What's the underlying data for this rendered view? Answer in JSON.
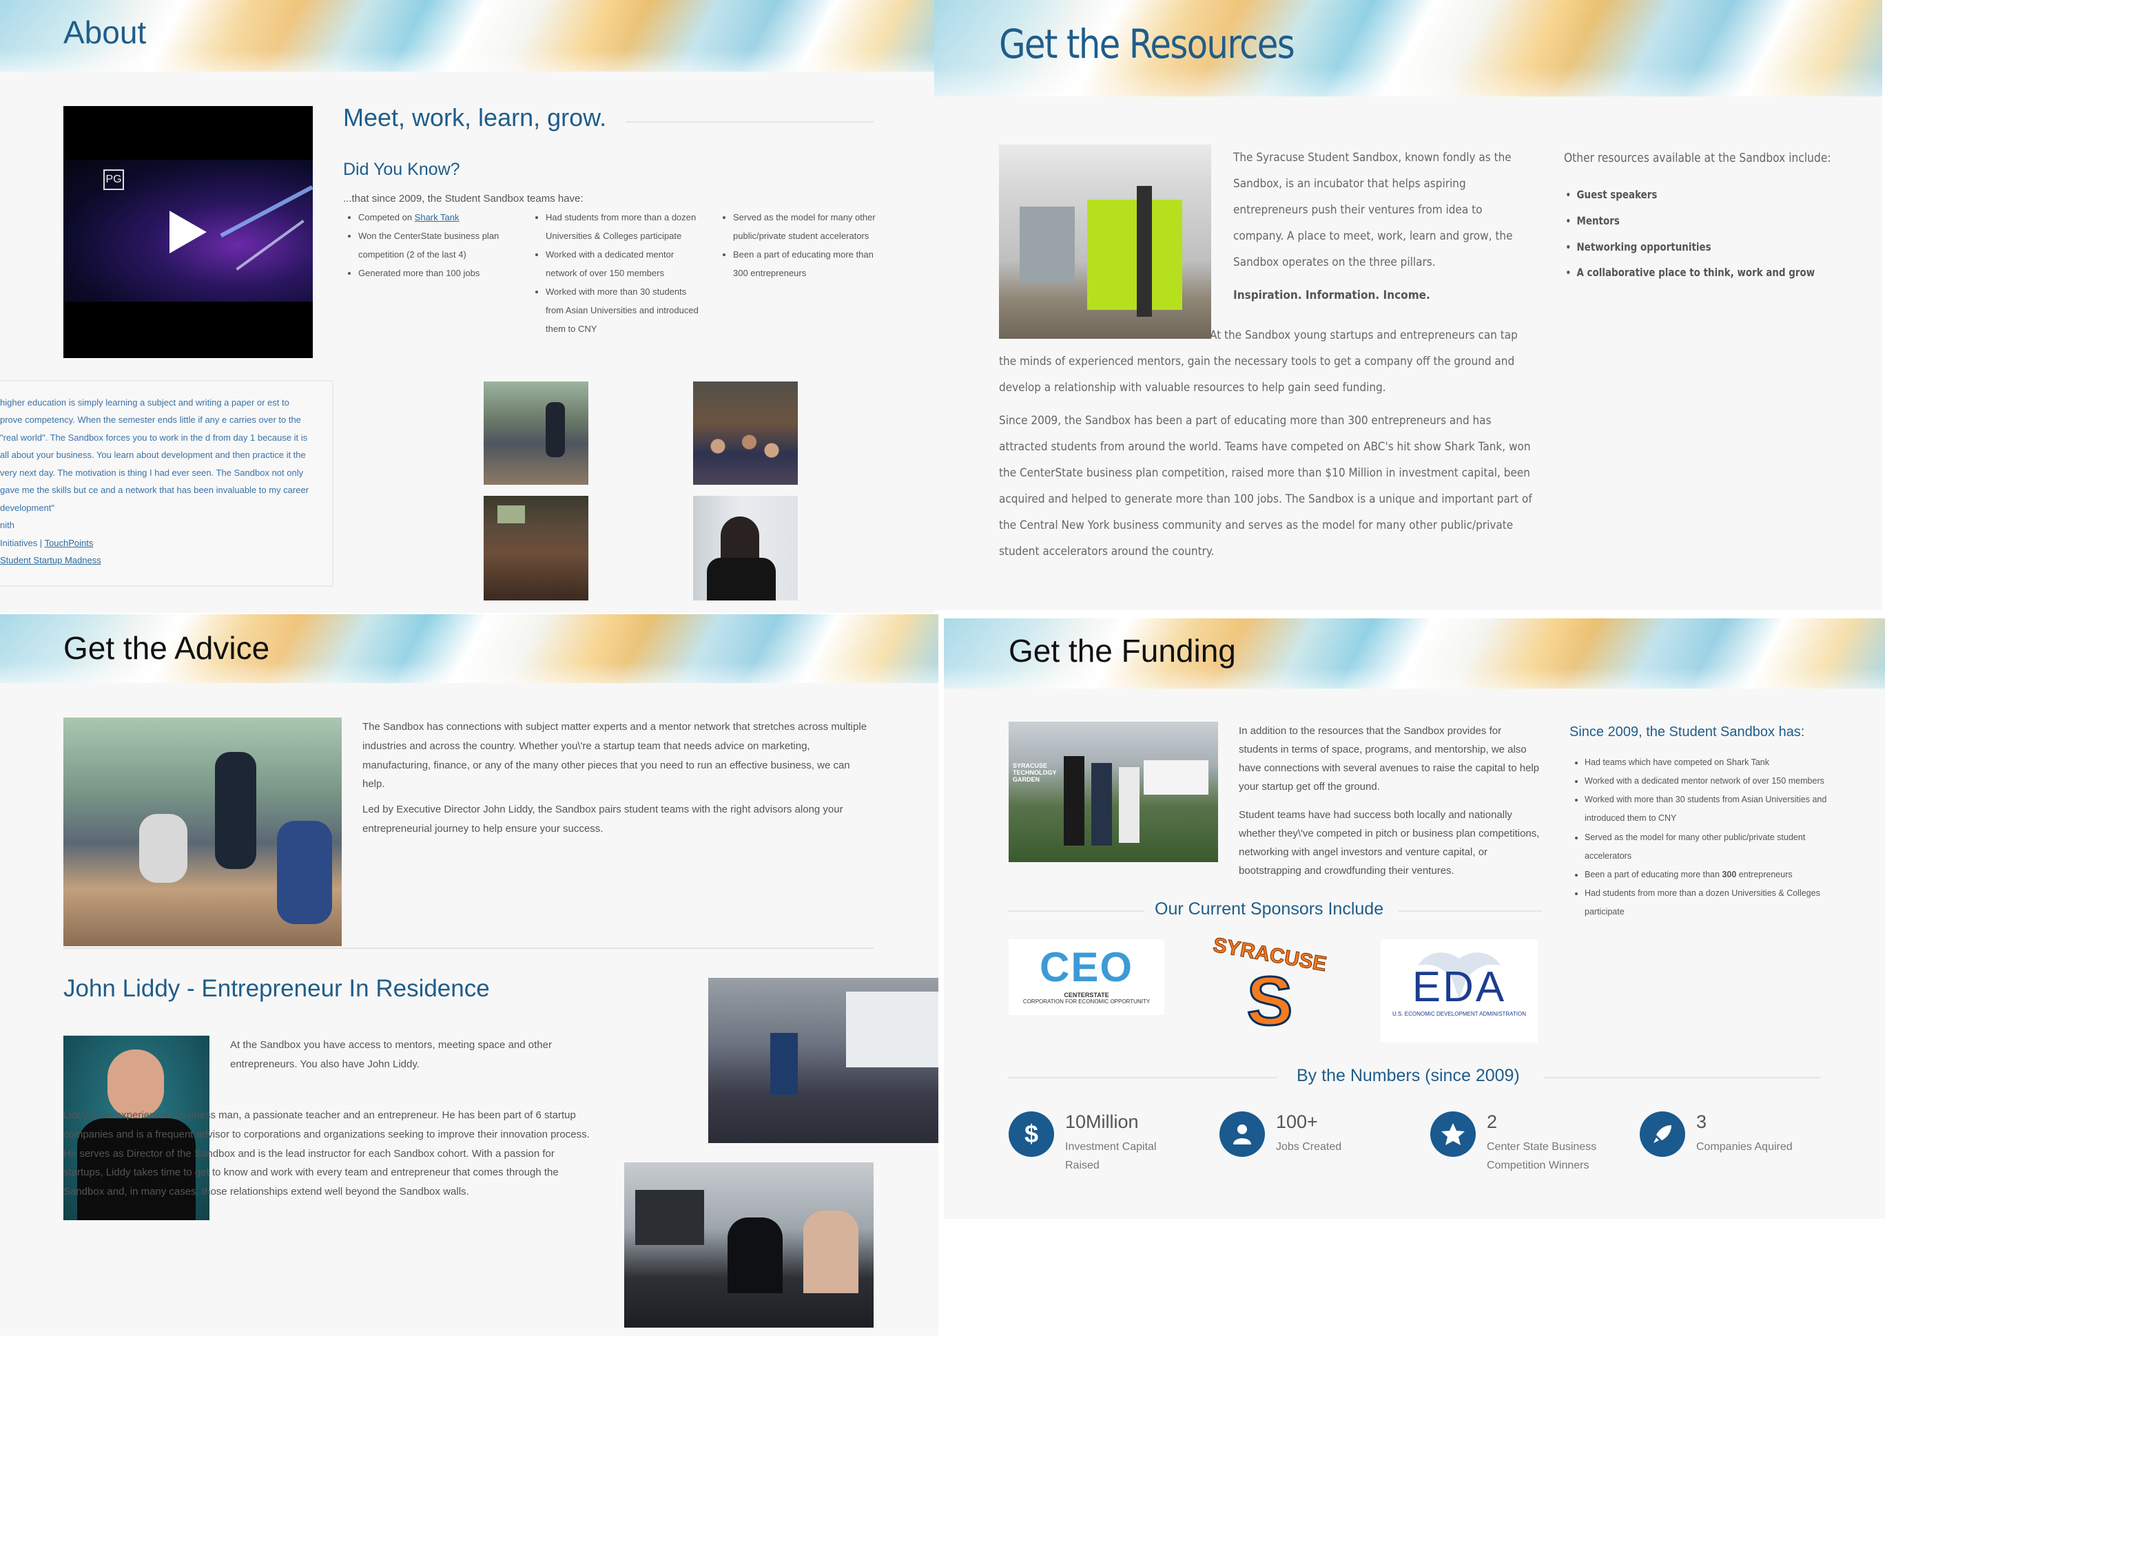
{
  "about": {
    "title": "About",
    "heading": "Meet, work, learn, grow.",
    "subheading": "Did You Know?",
    "intro": "...that since 2009, the Student Sandbox teams have:",
    "col1": {
      "item1_prefix": "Competed on ",
      "item1_link": "Shark Tank",
      "item2": "Won the CenterState business plan competition (2 of the last 4)",
      "item3": "Generated more than 100 jobs"
    },
    "col2": [
      "Had students from more than a dozen Universities & Colleges participate",
      "Worked with a dedicated mentor network of over 150 members",
      "Worked with more than 30 students from Asian Universities and introduced them to CNY"
    ],
    "col3": [
      "Served as the model for many other public/private student accelerators",
      "Been a part of educating more than 300 entrepreneurs"
    ],
    "video_badge": "PG",
    "quote": "higher education is simply learning a subject and writing a paper or est to prove competency. When the semester ends little if any e carries over to the \"real world\". The Sandbox forces you to work in the d from day 1 because it is all about your business. You learn about development and then practice it the very next day. The motivation is thing I had ever seen. The Sandbox not only gave me the skills but ce and a network that has been invaluable to my career development\"",
    "quote_author": "nith",
    "quote_links": {
      "prefix": "Initiatives | ",
      "link1": "TouchPoints",
      "link2": "Student Startup Madness"
    }
  },
  "resources": {
    "title": "Get the Resources",
    "p1": "The Syracuse Student Sandbox, known fondly as the Sandbox, is an incubator that helps aspiring entrepreneurs push their ventures from idea to company. A place to meet, work, learn and grow, the Sandbox operates on the three pillars.",
    "pillars": "Inspiration. Information. Income.",
    "p2": "At the Sandbox young startups and entrepreneurs can tap the minds of experienced mentors, gain the necessary tools to get a company off the ground and develop a relationship with valuable resources to help gain seed funding.",
    "p3": "Since 2009, the Sandbox has been a part of educating more than 300 entrepreneurs and has attracted students from around the world. Teams have competed on ABC's hit show Shark Tank, won the CenterState business plan competition, raised more than $10 Million in investment capital, been acquired and helped to generate more than 100 jobs. The Sandbox is a unique and important part of the Central New York business community and serves as the model for many other public/private student accelerators around the country.",
    "other_heading": "Other resources available at the Sandbox include:",
    "other_items": [
      "Guest speakers",
      "Mentors",
      "Networking opportunities",
      "A collaborative place to think, work and grow"
    ]
  },
  "advice": {
    "title": "Get the Advice",
    "p1": "The Sandbox has connections with subject matter experts and a mentor network that stretches across multiple industries and across the country. Whether you\\'re a startup team that needs advice on marketing, manufacturing, finance, or any of the many other pieces that you need to run an effective business, we can help.",
    "p2": "Led by Executive Director John Liddy, the Sandbox pairs student teams with the right advisors along your entrepreneurial journey to help ensure your success.",
    "eir_heading": "John Liddy - Entrepreneur In Residence",
    "eir_p1": "At the Sandbox you have access to mentors, meeting space and other entrepreneurs. You also have John Liddy.",
    "eir_p2": "Liddy is an experienced business man, a passionate teacher and an entrepreneur. He has been part of 6 startup companies and is a frequent advisor to corporations and organizations seeking to improve their innovation process. He serves as Director of the Sandbox and is the lead instructor for each Sandbox cohort. With a passion for startups, Liddy takes time to get to know and work with every team and entrepreneur that comes through the Sandbox and, in many cases, those relationships extend well beyond the Sandbox walls."
  },
  "funding": {
    "title": "Get the Funding",
    "p1": "In addition to the resources that the Sandbox provides for students in terms of space, programs, and mentorship, we also have connections with several avenues to raise the capital to help your startup get off the ground.",
    "p2": "Student teams have had success both locally and nationally whether they\\'ve competed in pitch or business plan competitions, networking with angel investors and venture capital, or bootstrapping and crowdfunding their ventures.",
    "since_heading": "Since 2009, the Student Sandbox has:",
    "since_items": [
      "Had teams which have competed on Shark Tank",
      "Worked with a dedicated mentor network of over 150 members",
      "Worked with more than 30 students from Asian Universities and introduced them to CNY",
      "Served as the model for many other public/private student accelerators"
    ],
    "since_item5_prefix": "Been a part of educating more than ",
    "since_item5_bold": "300",
    "since_item5_suffix": " entrepreneurs",
    "since_item6": "Had students from more than a dozen Universities & Colleges participate",
    "sponsors_heading": "Our Current Sponsors Include",
    "ceo_logo": "CEO",
    "ceo_sub1": "CENTERSTATE",
    "ceo_sub2": "CORPORATION FOR ECONOMIC OPPORTUNITY",
    "syracuse_logo": "SYRACUSE",
    "syracuse_s": "S",
    "eda_logo": "EDA",
    "eda_sub": "U.S. ECONOMIC DEVELOPMENT ADMINISTRATION",
    "numbers_heading": "By the Numbers (since 2009)",
    "stats": [
      {
        "value": "10Million",
        "label": "Investment Capital Raised",
        "icon": "$"
      },
      {
        "value": "100+",
        "label": "Jobs Created",
        "icon": "person"
      },
      {
        "value": "2",
        "label": "Center State Business Competition Winners",
        "icon": "star"
      },
      {
        "value": "3",
        "label": "Companies Aquired",
        "icon": "rocket"
      }
    ],
    "photo_sign": "SYRACUSE TECHNOLOGY GARDEN"
  },
  "colors": {
    "accent": "#1f5d8a",
    "stat_circle": "#1a5a8e",
    "lime": "#b6e01e"
  }
}
